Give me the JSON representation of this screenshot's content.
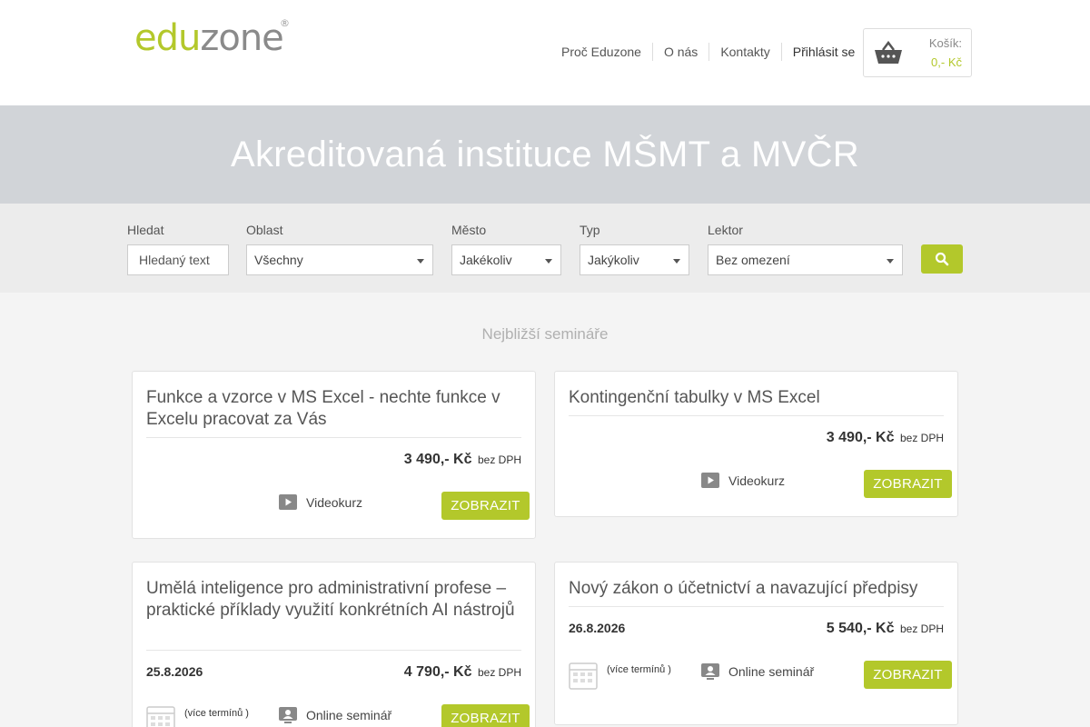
{
  "header": {
    "logo_green": "edu",
    "logo_gray": "zone",
    "logo_reg": "®",
    "nav": [
      "Proč Eduzone",
      "O nás",
      "Kontakty",
      "Přihlásit se"
    ],
    "cart_label": "Košík:",
    "cart_price": "0,- Kč"
  },
  "banner": {
    "title": "Akreditovaná instituce MŠMT a MVČR"
  },
  "filters": {
    "search_label": "Hledat",
    "search_placeholder": "Hledaný text",
    "area_label": "Oblast",
    "area_value": "Všechny",
    "city_label": "Město",
    "city_value": "Jakékoliv",
    "type_label": "Typ",
    "type_value": "Jakýkoliv",
    "lector_label": "Lektor",
    "lector_value": "Bez omezení",
    "search_icon": "search-icon"
  },
  "section": {
    "title": "Nejbližší semináře"
  },
  "cards": [
    {
      "title": "Funkce a vzorce v MS Excel - nechte funkce v Excelu pracovat za Vás",
      "price": "3 490,- Kč",
      "price_note": "bez DPH",
      "type": "Videokurz",
      "type_icon": "play-icon",
      "button": "ZOBRAZIT"
    },
    {
      "title": "Kontingenční tabulky v MS Excel",
      "price": "3 490,- Kč",
      "price_note": "bez DPH",
      "type": "Videokurz",
      "type_icon": "play-icon",
      "button": "ZOBRAZIT"
    },
    {
      "title": "Umělá inteligence pro administrativní profese – praktické příklady využití konkrétních AI nástrojů",
      "date": "25.8.2026",
      "price": "4 790,- Kč",
      "price_note": "bez DPH",
      "more": "(více termínů )",
      "type": "Online seminář",
      "type_icon": "online-seminar-icon",
      "button": "ZOBRAZIT"
    },
    {
      "title": "Nový zákon o účetnictví a navazující předpisy",
      "date": "26.8.2026",
      "price": "5 540,- Kč",
      "price_note": "bez DPH",
      "more": "(více termínů )",
      "type": "Online seminář",
      "type_icon": "online-seminar-icon",
      "button": "ZOBRAZIT"
    }
  ],
  "colors": {
    "accent": "#b3c82b",
    "banner": "#d1d4d8"
  }
}
